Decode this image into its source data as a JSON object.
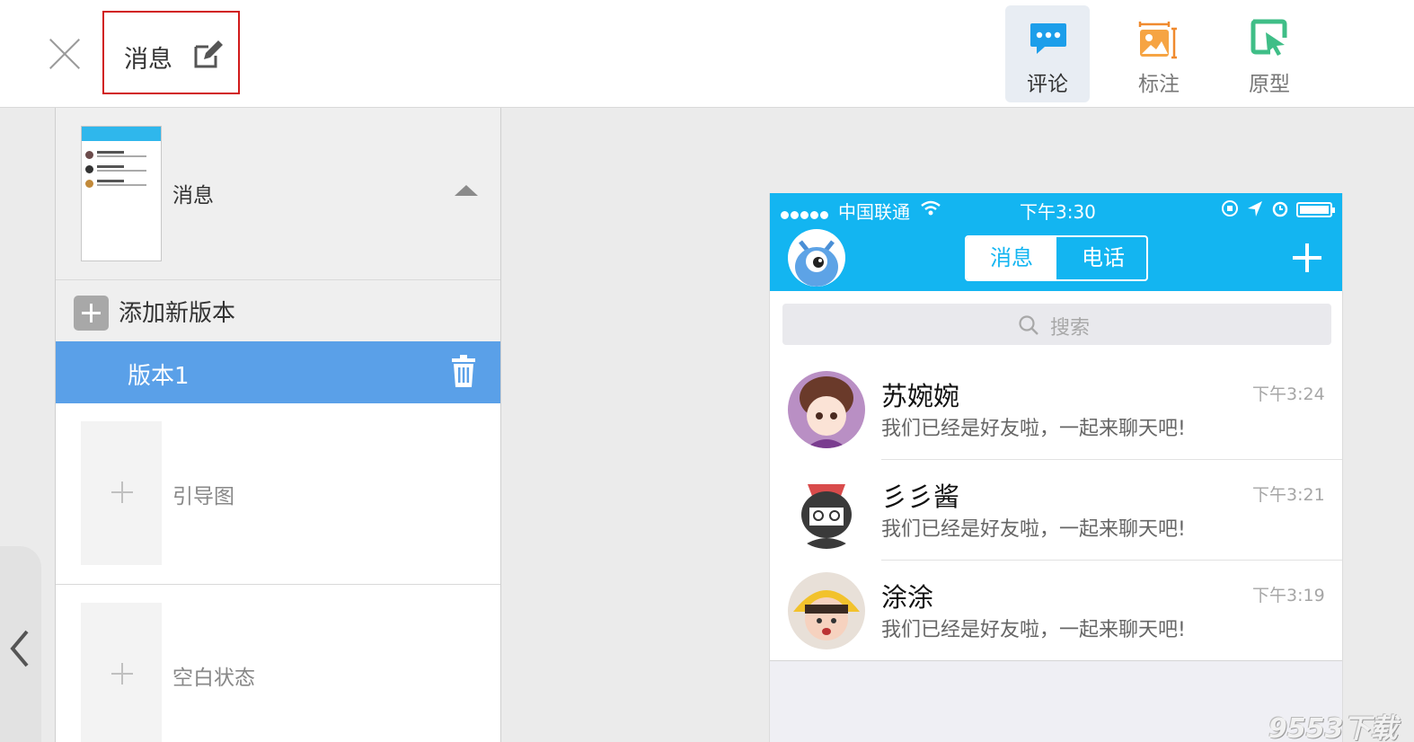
{
  "header": {
    "title": "消息",
    "tools": [
      {
        "label": "评论",
        "icon": "comment-icon",
        "active": true
      },
      {
        "label": "标注",
        "icon": "annotation-icon",
        "active": false
      },
      {
        "label": "原型",
        "icon": "prototype-icon",
        "active": false
      }
    ]
  },
  "panel": {
    "page_name": "消息",
    "add_version_label": "添加新版本",
    "version_label": "版本1",
    "slots": [
      "引导图",
      "空白状态"
    ]
  },
  "phone": {
    "carrier": "中国联通",
    "time": "下午3:30",
    "tabs": [
      "消息",
      "电话"
    ],
    "search_placeholder": "搜索",
    "chats": [
      {
        "name": "苏婉婉",
        "message": "我们已经是好友啦，一起来聊天吧!",
        "time": "下午3:24"
      },
      {
        "name": "彡彡酱",
        "message": "我们已经是好友啦，一起来聊天吧!",
        "time": "下午3:21"
      },
      {
        "name": "涂涂",
        "message": "我们已经是好友啦，一起来聊天吧!",
        "time": "下午3:19"
      }
    ]
  },
  "colors": {
    "accent": "#13b5f1",
    "selected_version": "#5aa0e8",
    "highlight_box": "#d11b1b"
  },
  "watermark": "9553下载"
}
